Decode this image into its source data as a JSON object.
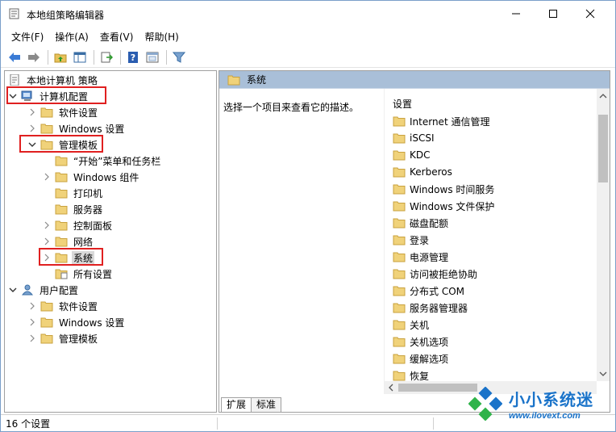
{
  "window": {
    "title": "本地组策略编辑器"
  },
  "menu": [
    "文件(F)",
    "操作(A)",
    "查看(V)",
    "帮助(H)"
  ],
  "toolbar": {
    "buttons": [
      "back-icon",
      "forward-icon",
      "up-folder-icon",
      "show-hide-tree-icon",
      "export-list-icon",
      "help-icon",
      "properties-icon",
      "filter-icon"
    ]
  },
  "tree": {
    "root": "本地计算机 策略",
    "computer_config": "计算机配置",
    "cc_software": "软件设置",
    "cc_windows": "Windows 设置",
    "cc_admin": "管理模板",
    "at_start": "“开始”菜单和任务栏",
    "at_components": "Windows 组件",
    "at_printers": "打印机",
    "at_servers": "服务器",
    "at_control": "控制面板",
    "at_network": "网络",
    "at_system": "系统",
    "at_all": "所有设置",
    "user_config": "用户配置",
    "uc_software": "软件设置",
    "uc_windows": "Windows 设置",
    "uc_admin": "管理模板"
  },
  "right": {
    "header": "系统",
    "description": "选择一个项目来查看它的描述。",
    "list_header": "设置",
    "items": [
      "Internet 通信管理",
      "iSCSI",
      "KDC",
      "Kerberos",
      "Windows 时间服务",
      "Windows 文件保护",
      "磁盘配额",
      "登录",
      "电源管理",
      "访问被拒绝协助",
      "分布式 COM",
      "服务器管理器",
      "关机",
      "关机选项",
      "缓解选项",
      "恢复"
    ],
    "tabs": [
      "扩展",
      "标准"
    ]
  },
  "status": {
    "text": "16 个设置"
  },
  "watermark": {
    "title": "小小系统迷",
    "url": "www.ilovext.com"
  },
  "colors": {
    "highlight_box": "#e02020",
    "header_bg": "#a9bfd8",
    "folder": "#e8c25a",
    "watermark": "#1a73c9"
  }
}
